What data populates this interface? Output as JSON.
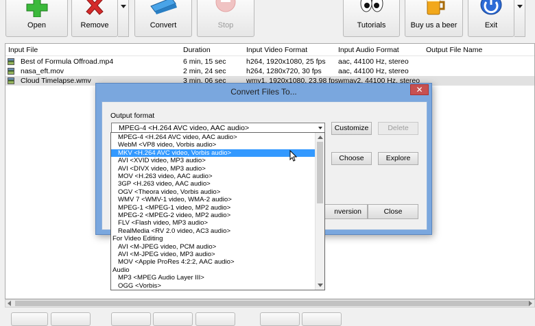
{
  "toolbar": {
    "open": "Open",
    "remove": "Remove",
    "convert": "Convert",
    "stop": "Stop",
    "tutorials": "Tutorials",
    "beer": "Buy us a beer",
    "exit": "Exit"
  },
  "columns": [
    "Input File",
    "Duration",
    "Input Video Format",
    "Input Audio Format",
    "Output File Name"
  ],
  "files": [
    {
      "name": "Best of Formula Offroad.mp4",
      "duration": "6 min, 15 sec",
      "video": "h264,  1920x1080,  25 fps",
      "audio": "aac,  44100 Hz, stereo"
    },
    {
      "name": "nasa_eft.mov",
      "duration": "2 min, 24 sec",
      "video": "h264,  1280x720,  30 fps",
      "audio": "aac,  44100 Hz, stereo"
    },
    {
      "name": "Cloud Timelapse.wmv",
      "duration": "3 min, 06 sec",
      "video": "wmv1,  1920x1080, 23.98 fps",
      "audio": "wmav2,  44100 Hz, stereo"
    }
  ],
  "dialog": {
    "title": "Convert Files To...",
    "close_glyph": "✕",
    "output_label": "Output format",
    "selected": "MPEG-4   <H.264 AVC video, AAC audio>",
    "customize": "Customize",
    "delete": "Delete",
    "choose": "Choose",
    "explore": "Explore",
    "start": "nversion",
    "close": "Close"
  },
  "formats": [
    "MPEG-4   <H.264 AVC video, AAC audio>",
    "WebM   <VP8 video, Vorbis audio>",
    "MKV   <H.264 AVC video, Vorbis audio>",
    "AVI   <XVID video, MP3 audio>",
    "AVI   <DIVX video, MP3 audio>",
    "MOV   <H.263 video, AAC audio>",
    "3GP   <H.263 video, AAC audio>",
    "OGV   <Theora video, Vorbis audio>",
    "WMV 7   <WMV-1 video, WMA-2 audio>",
    "MPEG-1   <MPEG-1 video, MP2 audio>",
    "MPEG-2   <MPEG-2 video, MP2 audio>",
    "FLV   <Flash video, MP3 audio>",
    "RealMedia   <RV 2.0 video, AC3 audio>",
    "For Video Editing",
    "AVI   <M-JPEG video, PCM audio>",
    "AVI   <M-JPEG video, MP3 audio>",
    "MOV   <Apple ProRes 4:2:2, AAC audio>",
    "Audio",
    "MP3   <MPEG Audio Layer III>",
    "OGG   <Vorbis>"
  ],
  "format_groups": [
    13,
    17
  ],
  "selected_index": 2,
  "colors": {
    "accent": "#3399ff",
    "dialog_frame": "#7aa7de",
    "close_red": "#c75050"
  }
}
